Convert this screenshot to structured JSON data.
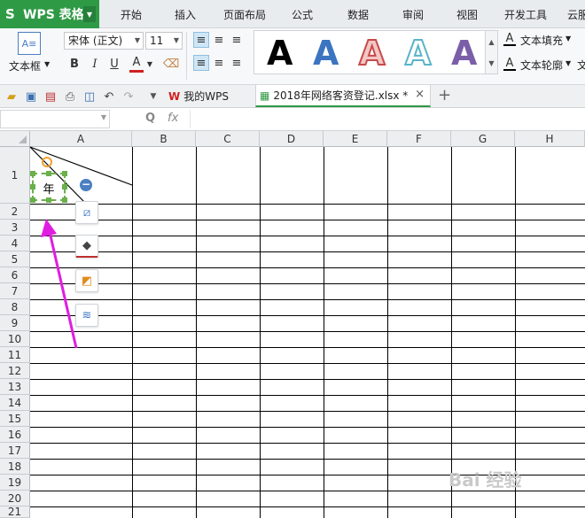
{
  "app": {
    "name": "WPS 表格",
    "logo_glyph": "S"
  },
  "menu": [
    "开始",
    "插入",
    "页面布局",
    "公式",
    "数据",
    "审阅",
    "视图",
    "开发工具",
    "云服"
  ],
  "ribbon": {
    "textbox_label": "文本框",
    "font_name": "宋体 (正文)",
    "font_size": "11",
    "bold": "B",
    "italic": "I",
    "underline": "U",
    "font_color_glyph": "A",
    "art_letter": "A",
    "text_fill_label": "文本填充",
    "text_outline_label": "文本轮廓",
    "text_effect_label": "文"
  },
  "qbar": {
    "wps_tab": "我的WPS",
    "doc_tab": "2018年网络客资登记.xlsx *",
    "close": "×",
    "add": "+"
  },
  "formula_bar": {
    "zoom_glyph": "Q",
    "fx": "fx"
  },
  "sheet": {
    "columns": [
      "A",
      "B",
      "C",
      "D",
      "E",
      "F",
      "G",
      "H"
    ],
    "rows": [
      "1",
      "2",
      "3",
      "4",
      "5",
      "6",
      "7",
      "8",
      "9",
      "10",
      "11",
      "12",
      "13",
      "14",
      "15",
      "16",
      "17",
      "18",
      "19",
      "20",
      "21"
    ],
    "textbox_text": "年"
  },
  "watermark": "Bai 经验",
  "colors": {
    "brand_green": "#2f9a45",
    "arrow_magenta": "#e01ee0",
    "selection_green": "#6ab04c"
  }
}
